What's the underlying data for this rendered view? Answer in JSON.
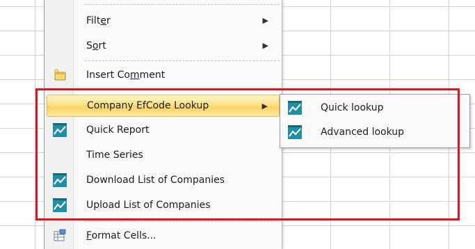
{
  "context_menu": {
    "items": [
      {
        "label_pre": "Filt",
        "label_ul": "e",
        "label_post": "r",
        "submenu_arrow": "▶"
      },
      {
        "label_pre": "S",
        "label_ul": "o",
        "label_post": "rt",
        "submenu_arrow": "▶"
      },
      {
        "label_pre": "Insert Co",
        "label_ul": "m",
        "label_post": "ment",
        "icon": "insert-comment-icon"
      },
      {
        "label": "Company EfCode Lookup",
        "submenu_arrow": "▶",
        "icon": "none"
      },
      {
        "label": "Quick Report",
        "icon": "chart-icon"
      },
      {
        "label": "Time Series",
        "icon": "none"
      },
      {
        "label": "Download List of Companies",
        "icon": "chart-icon"
      },
      {
        "label": "Upload List of Companies",
        "icon": "chart-icon"
      },
      {
        "label_pre": "",
        "label_ul": "F",
        "label_post": "ormat Cells...",
        "icon": "format-cells-icon"
      }
    ]
  },
  "submenu": {
    "items": [
      {
        "label": "Quick lookup",
        "icon": "chart-icon"
      },
      {
        "label": "Advanced lookup",
        "icon": "chart-icon"
      }
    ]
  },
  "colors": {
    "annotation": "#e3121b",
    "highlight": "#fcd361",
    "chart_icon": "#1f8fa3"
  }
}
